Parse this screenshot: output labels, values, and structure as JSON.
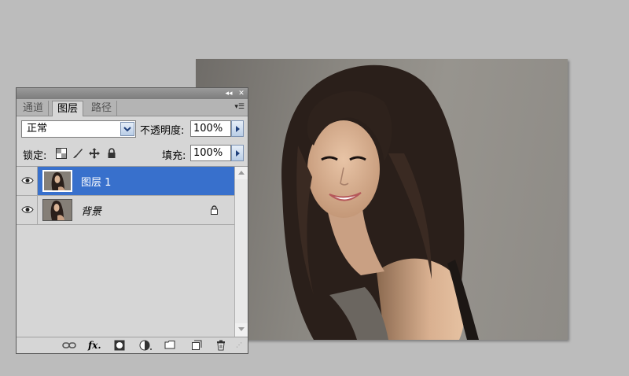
{
  "panel": {
    "tabs": [
      {
        "label": "通道",
        "active": false
      },
      {
        "label": "图层",
        "active": true
      },
      {
        "label": "路径",
        "active": false
      }
    ],
    "blend_mode": "正常",
    "opacity_label": "不透明度:",
    "opacity_value": "100%",
    "lock_label": "锁定:",
    "fill_label": "填充:",
    "fill_value": "100%",
    "layers": [
      {
        "name": "图层 1",
        "selected": true,
        "visible": true,
        "locked": false
      },
      {
        "name": "背景",
        "selected": false,
        "visible": true,
        "locked": true
      }
    ],
    "bottom_icons": [
      "link-icon",
      "fx-icon",
      "mask-icon",
      "adjustment-icon",
      "group-folder-icon",
      "new-layer-icon",
      "trash-icon"
    ]
  },
  "colors": {
    "selection": "#3870cc",
    "panel_bg": "#d6d6d6",
    "workspace_bg": "#bcbcbc"
  }
}
